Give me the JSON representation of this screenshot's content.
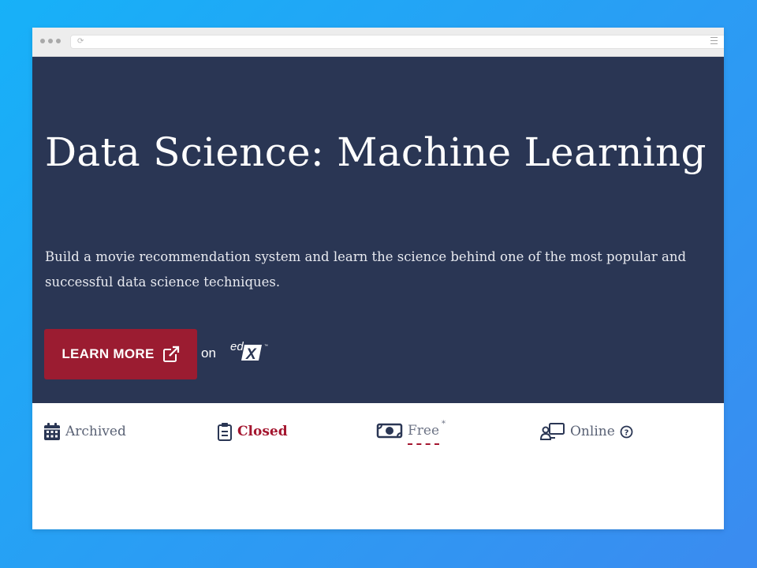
{
  "course": {
    "title": "Data Science: Machine Learning",
    "description": "Build a movie recommendation system and learn the science behind one of the most popular and successful data science techniques.",
    "cta_label": "LEARN MORE",
    "on_label": "on",
    "provider_logo": "edX",
    "colors": {
      "hero_bg": "#2a3654",
      "cta_bg": "#9b1c31",
      "page_bg_start": "#17b1f8",
      "page_bg_end": "#3b8bf0",
      "closed": "#a4162f"
    }
  },
  "meta": {
    "status": {
      "label": "Archived",
      "icon": "calendar-icon"
    },
    "enrollment": {
      "label": "Closed",
      "icon": "clipboard-icon"
    },
    "price": {
      "label": "Free",
      "marker": "*",
      "icon": "money-icon"
    },
    "format": {
      "label": "Online",
      "icon": "online-learning-icon",
      "help_icon": "question-circle-icon"
    }
  }
}
